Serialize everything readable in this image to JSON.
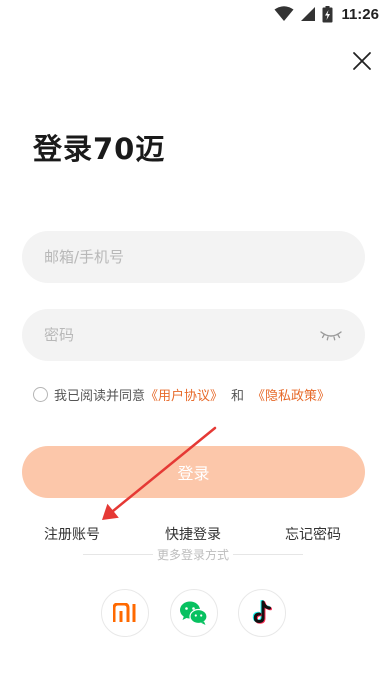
{
  "status_bar": {
    "time": "11:26",
    "icons": [
      "wifi-icon",
      "cellular-signal-icon",
      "battery-charging-icon"
    ]
  },
  "header": {
    "close_icon": "close-icon",
    "title": "登录70迈"
  },
  "form": {
    "email_placeholder": "邮箱/手机号",
    "email_value": "",
    "password_placeholder": "密码",
    "password_value": "",
    "eye_icon": "eye-closed-icon"
  },
  "agreement": {
    "checked": false,
    "prefix": "我已阅读并同意",
    "user_agreement": "《用户协议》",
    "and": "和",
    "privacy_policy": "《隐私政策》"
  },
  "actions": {
    "login_label": "登录",
    "register_label": "注册账号",
    "quick_login_label": "快捷登录",
    "forgot_password_label": "忘记密码"
  },
  "more_login": {
    "label": "更多登录方式",
    "providers": [
      "xiaomi-logo-icon",
      "wechat-icon",
      "tiktok-icon"
    ]
  },
  "colors": {
    "accent": "#e76a2a",
    "login_button": "#fcc7aa",
    "input_background": "#f3f3f3",
    "xiaomi_orange": "#ff6900",
    "wechat_green": "#07c160",
    "annotation_red": "#e53935"
  }
}
